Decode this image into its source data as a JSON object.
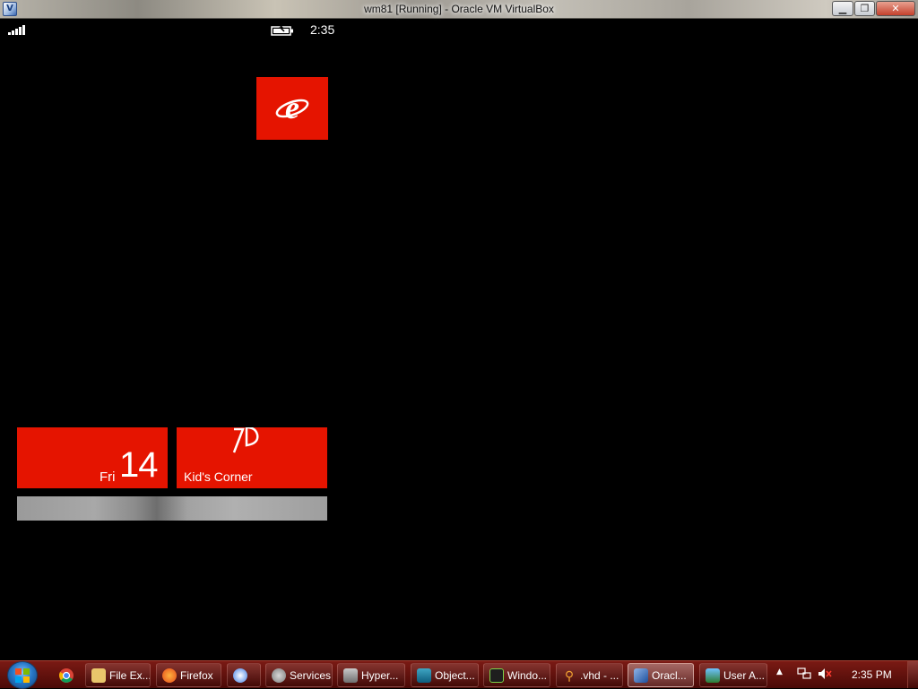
{
  "window": {
    "title": "wm81 [Running] - Oracle VM VirtualBox",
    "app_icon": "virtualbox-icon",
    "controls": [
      "minimize-icon",
      "maximize-icon",
      "close-icon"
    ]
  },
  "phone_status": {
    "signal_icon": "signal-bars-icon",
    "battery_icon": "battery-charging-icon",
    "time": "2:35"
  },
  "tiles": {
    "internet_explorer": {
      "icon": "internet-explorer-icon",
      "color": "#e51400"
    },
    "calendar": {
      "day": "Fri",
      "date": "14",
      "color": "#e51400"
    },
    "kids_corner": {
      "label": "Kid's Corner",
      "icon": "kids-corner-icon",
      "color": "#e51400"
    },
    "photos": {
      "icon": "photo-tile"
    }
  },
  "taskbar": {
    "start_icon": "windows-start-orb-icon",
    "pinned": [
      {
        "name": "chrome",
        "icon": "chrome-icon"
      }
    ],
    "items": [
      {
        "label": "File Ex...",
        "icon": "folder-icon"
      },
      {
        "label": "Firefox",
        "icon": "firefox-icon"
      },
      {
        "label": "",
        "icon": "browser-icon"
      },
      {
        "label": "Services",
        "icon": "gear-icon"
      },
      {
        "label": "Hyper...",
        "icon": "hyper-v-icon"
      },
      {
        "label": "Object...",
        "icon": "object-explorer-icon"
      },
      {
        "label": "Windo...",
        "icon": "console-icon"
      },
      {
        "label": ".vhd - ...",
        "icon": "search-icon"
      },
      {
        "label": "Oracl...",
        "icon": "virtualbox-icon"
      },
      {
        "label": "User A...",
        "icon": "users-icon"
      }
    ],
    "tray": {
      "arrow_icon": "tray-expand-icon",
      "network_icon": "network-icon",
      "volume_icon": "volume-muted-icon"
    },
    "clock": "2:35 PM"
  }
}
